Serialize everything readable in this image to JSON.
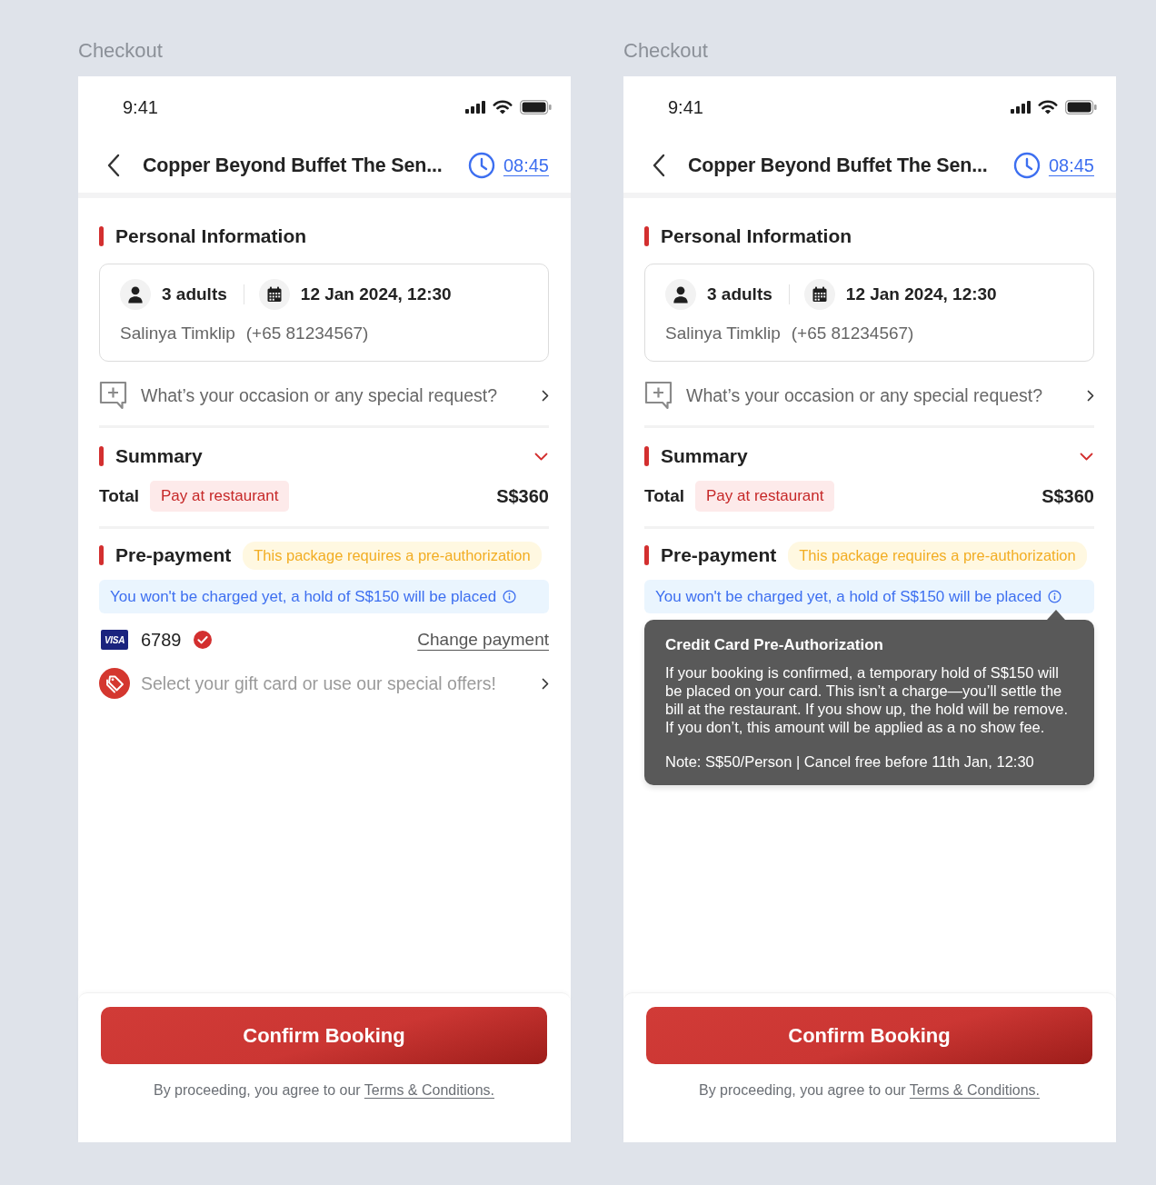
{
  "screens": [
    {
      "label": "Checkout",
      "status_bar": {
        "time": "9:41"
      },
      "header": {
        "title": "Copper Beyond Buffet The Sen...",
        "timer": "08:45"
      },
      "personal_information": {
        "heading": "Personal Information",
        "guests": "3 adults",
        "date_time": "12 Jan 2024, 12:30",
        "name": "Salinya Timklip",
        "phone": "(+65 81234567)"
      },
      "special_request": {
        "label": "What’s your occasion or any special request?"
      },
      "summary": {
        "heading": "Summary",
        "total_label": "Total",
        "payment_badge": "Pay at restaurant",
        "total": "S$360"
      },
      "prepayment": {
        "heading": "Pre-payment",
        "badge": "This package requires a pre-authorization",
        "notice": "You won't be charged yet, a hold of S$150 will be placed",
        "card": {
          "brand": "VISA",
          "last_digits": "6789",
          "selected": true
        },
        "change_link": "Change payment",
        "offers": "Select your gift card or use our special offers!"
      },
      "footer": {
        "button": "Confirm Booking",
        "agreement": "By proceeding, you agree to our",
        "terms_link": "Terms & Conditions."
      }
    },
    {
      "label": "Checkout",
      "status_bar": {
        "time": "9:41"
      },
      "header": {
        "title": "Copper Beyond Buffet The Sen...",
        "timer": "08:45"
      },
      "personal_information": {
        "heading": "Personal Information",
        "guests": "3 adults",
        "date_time": "12 Jan 2024, 12:30",
        "name": "Salinya Timklip",
        "phone": "(+65 81234567)"
      },
      "special_request": {
        "label": "What’s your occasion or any special request?"
      },
      "summary": {
        "heading": "Summary",
        "total_label": "Total",
        "payment_badge": "Pay at restaurant",
        "total": "S$360"
      },
      "prepayment": {
        "heading": "Pre-payment",
        "badge": "This package requires a pre-authorization",
        "notice": "You won't be charged yet, a hold of S$150 will be placed",
        "tooltip": {
          "title": "Credit Card Pre-Authorization",
          "body": "If your booking is confirmed, a temporary hold of S$150 will be placed on your card. This isn’t a charge—you’ll settle the bill at the restaurant. If you show up, the hold will be remove. If you don’t, this amount will be applied as a no show fee.",
          "note": "Note: S$50/Person | Cancel free before 11th Jan, 12:30"
        }
      },
      "footer": {
        "button": "Confirm Booking",
        "agreement": "By proceeding, you agree to our",
        "terms_link": "Terms & Conditions."
      }
    }
  ]
}
